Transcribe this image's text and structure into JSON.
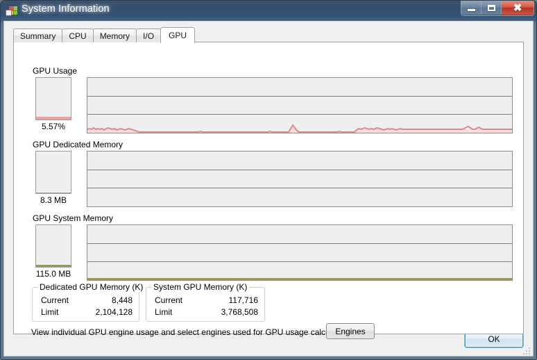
{
  "window": {
    "title": "System Information",
    "icon": "process-explorer-icon",
    "controls": {
      "minimize": "minimize-icon",
      "maximize": "maximize-icon",
      "close": "close-icon"
    }
  },
  "tabs": [
    {
      "label": "Summary",
      "active": false
    },
    {
      "label": "CPU",
      "active": false
    },
    {
      "label": "Memory",
      "active": false
    },
    {
      "label": "I/O",
      "active": false
    },
    {
      "label": "GPU",
      "active": true
    }
  ],
  "sections": [
    {
      "title": "GPU Usage",
      "gauge_label": "5.57%",
      "gauge_percent": 5.57,
      "color": "#e08a8a",
      "fill_color": "#e8a0a0"
    },
    {
      "title": "GPU Dedicated Memory",
      "gauge_label": "8.3 MB",
      "gauge_percent": 0.4,
      "color": "#9a9a4e",
      "fill_color": "#b0b060"
    },
    {
      "title": "GPU System Memory",
      "gauge_label": "115.0 MB",
      "gauge_percent": 3.0,
      "color": "#8c8c3c",
      "fill_color": "#a0a050"
    }
  ],
  "groupboxes": [
    {
      "title": "Dedicated GPU Memory (K)",
      "rows": [
        {
          "label": "Current",
          "value": "8,448"
        },
        {
          "label": "Limit",
          "value": "2,104,128"
        }
      ]
    },
    {
      "title": "System GPU Memory (K)",
      "rows": [
        {
          "label": "Current",
          "value": "117,716"
        },
        {
          "label": "Limit",
          "value": "3,768,508"
        }
      ]
    }
  ],
  "engines": {
    "text": "View individual GPU engine usage and select engines used for GPU usage calculations:",
    "button_label": "Engines"
  },
  "footer": {
    "ok_label": "OK"
  },
  "chart_data": [
    {
      "type": "line",
      "title": "GPU Usage",
      "ylabel": "%",
      "ylim": [
        0,
        100
      ],
      "grid": true,
      "gridlines": 3,
      "current_value": 5.57,
      "unit": "%",
      "series": [
        {
          "name": "GPU Usage",
          "color": "#e08a8a",
          "values": [
            4,
            5,
            6,
            5,
            7,
            5,
            6,
            5,
            4,
            6,
            5,
            7,
            6,
            5,
            6,
            4,
            5,
            6,
            5,
            4,
            5,
            6,
            5,
            4,
            3,
            2,
            1,
            1,
            1,
            1,
            1,
            1,
            1,
            1,
            1,
            1,
            1,
            1,
            1,
            1,
            1,
            1,
            1,
            1,
            1,
            1,
            1,
            1,
            1,
            1,
            1,
            1,
            1,
            1,
            1,
            1,
            1,
            1,
            1,
            1,
            1,
            1,
            1,
            1,
            2,
            1,
            1,
            1,
            1,
            1,
            1,
            1,
            1,
            1,
            1,
            1,
            1,
            1,
            1,
            1,
            1,
            1,
            1,
            1,
            1,
            1,
            1,
            1,
            1,
            1,
            1,
            1,
            1,
            1,
            2,
            1,
            1,
            1,
            1,
            1,
            1,
            1,
            1,
            1,
            1,
            1,
            1,
            1,
            1,
            1,
            1,
            1,
            1,
            1,
            1,
            1,
            1,
            1,
            1,
            1,
            1,
            1,
            1,
            1,
            1,
            1,
            1,
            1,
            1,
            1,
            1,
            1,
            1,
            1,
            1,
            1,
            1,
            1,
            1,
            1,
            1,
            2,
            3,
            7,
            9,
            6,
            3,
            2,
            1,
            1,
            1,
            1,
            1,
            1,
            1,
            1,
            1,
            1,
            1,
            1,
            1,
            1,
            1,
            1,
            1,
            1,
            1,
            2,
            1,
            1,
            1,
            1,
            1,
            1,
            1,
            1,
            1,
            1,
            1,
            1,
            1,
            1,
            1,
            1,
            1,
            1,
            2,
            4,
            5,
            6,
            5,
            6,
            7,
            6,
            5,
            6,
            5,
            6,
            7,
            6,
            5,
            4,
            5,
            6,
            5,
            6,
            5,
            4,
            5,
            6,
            5,
            6,
            5,
            6,
            5,
            5,
            5,
            5,
            5,
            5,
            5,
            5,
            5,
            5,
            5,
            5,
            5,
            5,
            5,
            5,
            5,
            5,
            5,
            5,
            5,
            5,
            5,
            5,
            5,
            5,
            5,
            5,
            5,
            5,
            5,
            5,
            5,
            5,
            5,
            5,
            5,
            5,
            5,
            5,
            5,
            5,
            5,
            5,
            5,
            5,
            5,
            5,
            5,
            5,
            5,
            5,
            5,
            5,
            5,
            5,
            5,
            5,
            5,
            5,
            5,
            5,
            5,
            5,
            5,
            5,
            5,
            5,
            5,
            5,
            5,
            5,
            5,
            5,
            5,
            5,
            5,
            5,
            5,
            5,
            5,
            5,
            5,
            5,
            5,
            5,
            5,
            5,
            5,
            5,
            5,
            5,
            5,
            5,
            5,
            5,
            5,
            5,
            5,
            5,
            5,
            5,
            5,
            5,
            5,
            5,
            5,
            5,
            5,
            5,
            5,
            5,
            5,
            5,
            5,
            5,
            5,
            5,
            5,
            5,
            5,
            5,
            5,
            5,
            5,
            5,
            5,
            5,
            5,
            5,
            5,
            5,
            5,
            5,
            5,
            5,
            5,
            5,
            5,
            5,
            5,
            5,
            5,
            5,
            5,
            5,
            5,
            5,
            5,
            5,
            5,
            5,
            5,
            5,
            5,
            5,
            5,
            5,
            5,
            5,
            5,
            5,
            5,
            5,
            5,
            5,
            5,
            5,
            5,
            5,
            5,
            5,
            5,
            5,
            5,
            5,
            5,
            5,
            5,
            5,
            5,
            5,
            5,
            5,
            5,
            5,
            5,
            5,
            5,
            5,
            5,
            5,
            5,
            5,
            5,
            5,
            5,
            5,
            5,
            5,
            5,
            5,
            5,
            5,
            5,
            5,
            5,
            5,
            5,
            5,
            5,
            5,
            5,
            5,
            5,
            5,
            5,
            5,
            5,
            5,
            5,
            5,
            5,
            5,
            5,
            5,
            5,
            5,
            5,
            5,
            5,
            5,
            5,
            5,
            5,
            5,
            5,
            5,
            5,
            5,
            5,
            5,
            5,
            5,
            5,
            5,
            5,
            5,
            5,
            5,
            5,
            5,
            5,
            5,
            5,
            5,
            5,
            5,
            5,
            5,
            5,
            5,
            5,
            5,
            5,
            5,
            5,
            5,
            5,
            5,
            5,
            5,
            5,
            5,
            5,
            5,
            5,
            5,
            5,
            5,
            5,
            5,
            5,
            5,
            5,
            5,
            5,
            5,
            5,
            5,
            5,
            5,
            5,
            5,
            5,
            5,
            5,
            5,
            5,
            5,
            5,
            5,
            5,
            5,
            5,
            5,
            5,
            5,
            5,
            5,
            5,
            5,
            5,
            5,
            5,
            5,
            5,
            5,
            5,
            5,
            5,
            5,
            5,
            5,
            5,
            5,
            5,
            5,
            5,
            5,
            5,
            5,
            5,
            5,
            5,
            5,
            5,
            5,
            5,
            5,
            5,
            5,
            5,
            5,
            5,
            5,
            5,
            5,
            5,
            5,
            5,
            5,
            5,
            5,
            5,
            5,
            6,
            7,
            8,
            7,
            6,
            5,
            5,
            6,
            7,
            6,
            5,
            5,
            5,
            5,
            5,
            5,
            5,
            5,
            5,
            5,
            5,
            5,
            5,
            5,
            5,
            5,
            5,
            5,
            5,
            5,
            5,
            5,
            5,
            5,
            5,
            5,
            5,
            5,
            5,
            5,
            5,
            5,
            5
          ]
        }
      ]
    },
    {
      "type": "line",
      "title": "GPU Dedicated Memory",
      "ylim": [
        0,
        2104128
      ],
      "grid": true,
      "gridlines": 3,
      "current_value": 8448,
      "unit": "K",
      "series": [
        {
          "name": "GPU Dedicated Memory",
          "color": "#9a9a4e",
          "values": []
        }
      ]
    },
    {
      "type": "line",
      "title": "GPU System Memory",
      "ylim": [
        0,
        3768508
      ],
      "grid": true,
      "gridlines": 3,
      "current_value": 117716,
      "unit": "K",
      "series": [
        {
          "name": "GPU System Memory",
          "color": "#8c8c3c",
          "values": [
            3,
            3,
            3,
            3,
            3,
            3,
            3,
            3,
            3,
            3,
            3,
            3,
            3,
            3,
            3,
            3,
            3,
            3,
            3,
            3,
            3,
            3,
            3,
            3,
            3,
            3,
            3,
            3,
            3,
            3,
            3,
            3,
            3,
            3,
            3,
            3,
            3,
            3,
            3,
            3
          ]
        }
      ]
    }
  ]
}
